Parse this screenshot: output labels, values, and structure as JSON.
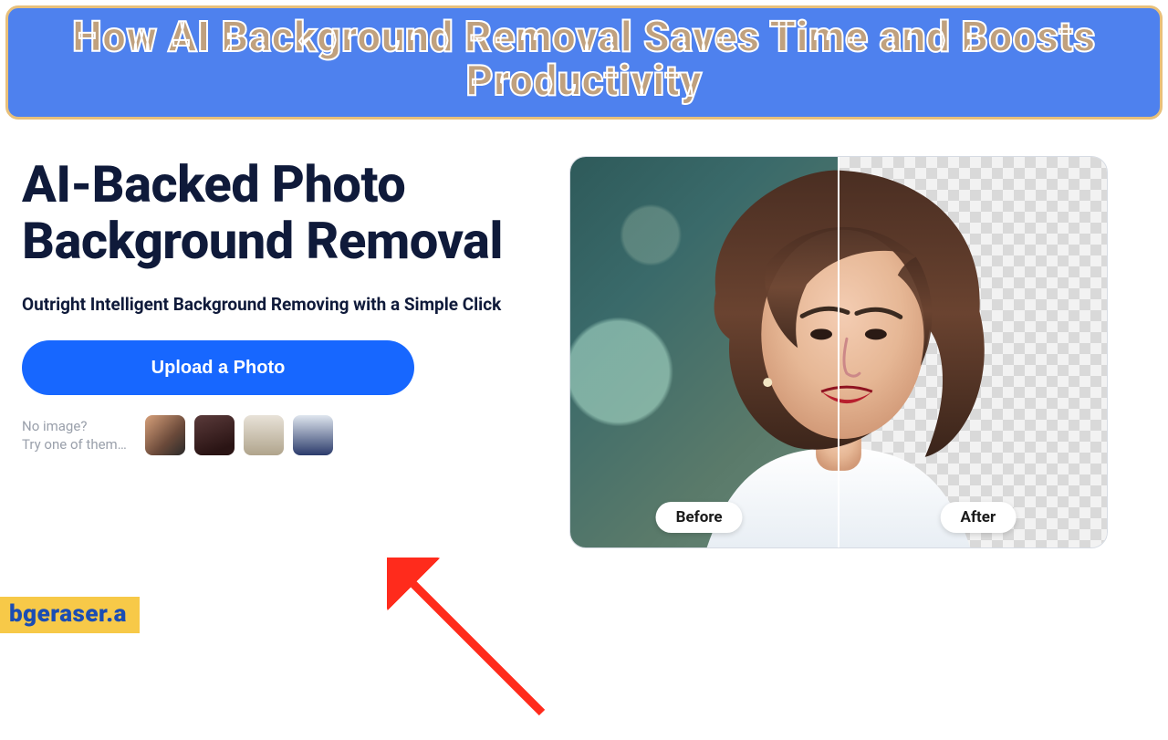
{
  "banner": {
    "title": "How AI Background Removal Saves Time and Boosts Productivity"
  },
  "hero": {
    "heading": "AI-Backed Photo Background Removal",
    "subheading": "Outright Intelligent Background Removing with a Simple Click",
    "upload_label": "Upload a Photo",
    "samples_prompt_line1": "No image?",
    "samples_prompt_line2": "Try one of them…",
    "sample_thumbs": [
      "sample-1",
      "sample-2",
      "sample-3",
      "sample-4"
    ]
  },
  "preview": {
    "before_label": "Before",
    "after_label": "After"
  },
  "watermark": "bgeraser.a",
  "colors": {
    "banner_bg": "#4e81ee",
    "banner_border": "#e8c07a",
    "accent_blue": "#1767ff",
    "arrow_red": "#ff2b1c",
    "watermark_bg": "#f7c948",
    "watermark_text": "#1b4db3"
  }
}
